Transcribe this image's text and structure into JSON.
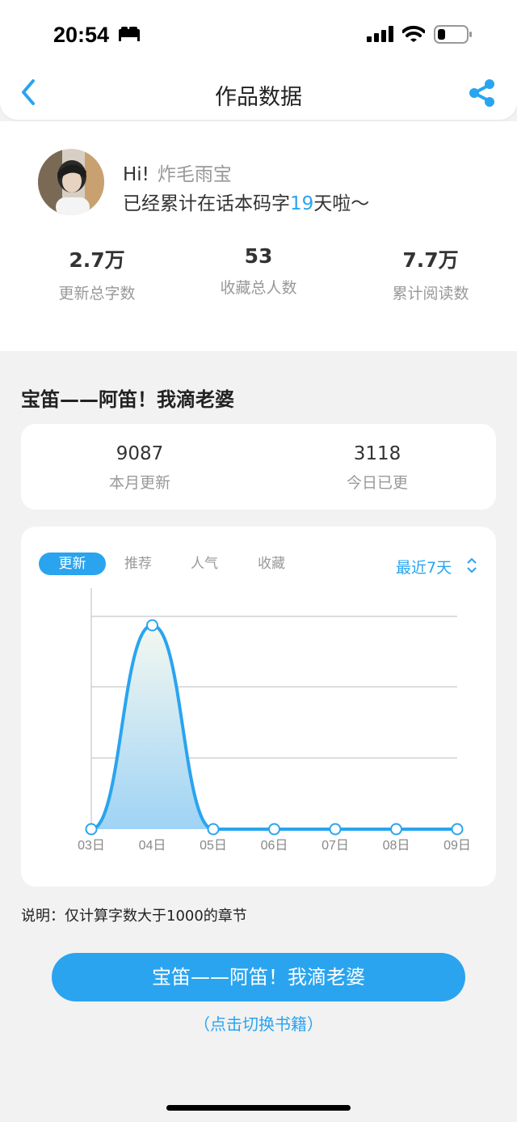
{
  "status_bar": {
    "time": "20:54"
  },
  "nav": {
    "title": "作品数据"
  },
  "profile": {
    "greeting": "Hi!",
    "username": "炸毛雨宝",
    "sub_prefix": "已经累计在话本码字",
    "days": "19",
    "sub_suffix": "天啦～",
    "stats": [
      {
        "value": "2.7万",
        "label": "更新总字数"
      },
      {
        "value": "53",
        "label": "收藏总人数"
      },
      {
        "value": "7.7万",
        "label": "累计阅读数"
      }
    ]
  },
  "book": {
    "title": "宝笛——阿笛！我滴老婆",
    "month_update_value": "9087",
    "month_update_label": "本月更新",
    "today_value": "3118",
    "today_label": "今日已更"
  },
  "tabs": [
    "更新",
    "推荐",
    "人气",
    "收藏"
  ],
  "range_label": "最近7天",
  "colors": {
    "accent": "#2aa4ef"
  },
  "chart_data": {
    "type": "area",
    "x": [
      "03日",
      "04日",
      "05日",
      "06日",
      "07日",
      "08日",
      "09日"
    ],
    "values": [
      0,
      1,
      0,
      0,
      0,
      0,
      0
    ],
    "grid": true,
    "smooth": true
  },
  "note": "说明：仅计算字数大于1000的章节",
  "switch_button": "宝笛——阿笛！我滴老婆",
  "switch_hint": "（点击切换书籍）"
}
